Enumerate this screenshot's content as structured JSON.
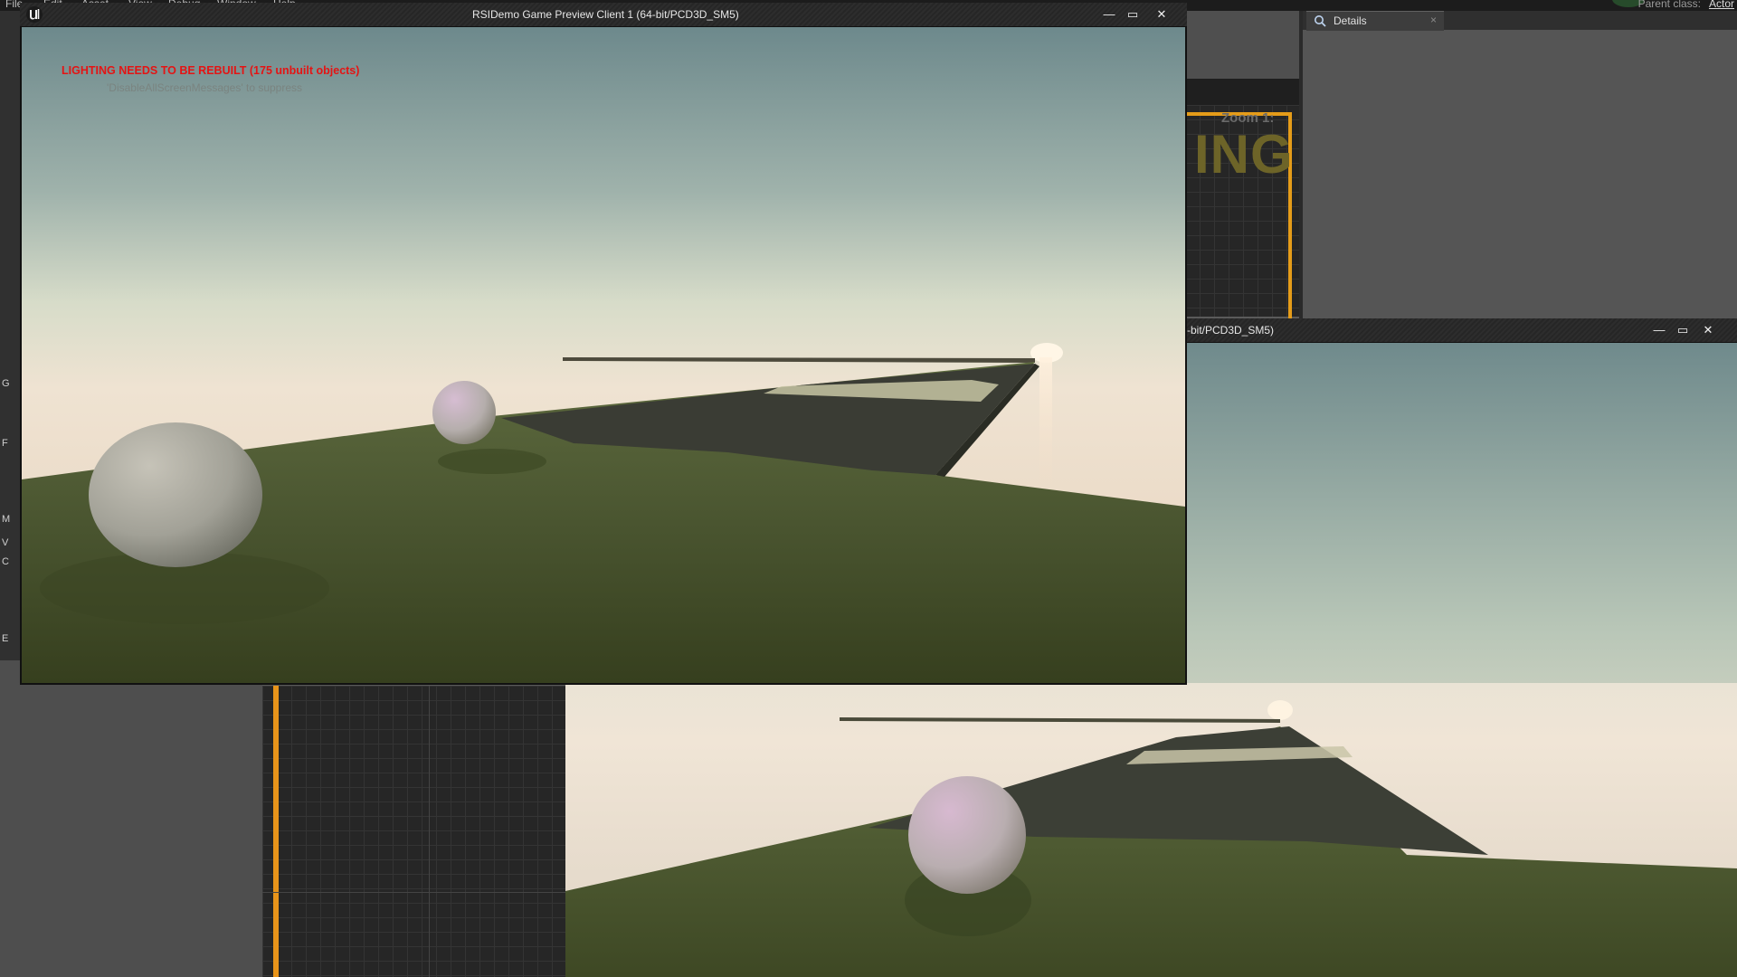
{
  "editor": {
    "menu": [
      "File",
      "Edit",
      "Asset",
      "View",
      "Debug",
      "Window",
      "Help"
    ],
    "parent_class_label": "Parent class:",
    "parent_class_value": "Actor",
    "left_strip_letters": [
      "G",
      "F",
      "M",
      "V",
      "C",
      "E"
    ],
    "blueprint": {
      "zoom_text": "Zoom 1:",
      "watermark_text": "ING"
    },
    "details_tab": {
      "label": "Details",
      "close": "×"
    }
  },
  "game_window_1": {
    "title": "RSIDemo Game Preview Client 1 (64-bit/PCD3D_SM5)",
    "warning": "LIGHTING NEEDS TO BE REBUILT (175 unbuilt objects)",
    "suppress_hint": "'DisableAllScreenMessages' to suppress",
    "controls": {
      "minimize": "—",
      "maximize": "▭",
      "close": "✕"
    }
  },
  "game_window_2": {
    "title": "-bit/PCD3D_SM5)",
    "controls": {
      "minimize": "—",
      "maximize": "▭",
      "close": "✕"
    }
  },
  "colors": {
    "warning_red": "#e41414",
    "node_orange": "#e59c19",
    "grass": "#4a5530",
    "sky_top": "#6f8a8c"
  },
  "icons": [
    "unreal-logo-icon",
    "minimize-icon",
    "maximize-icon",
    "close-icon",
    "details-search-icon"
  ]
}
